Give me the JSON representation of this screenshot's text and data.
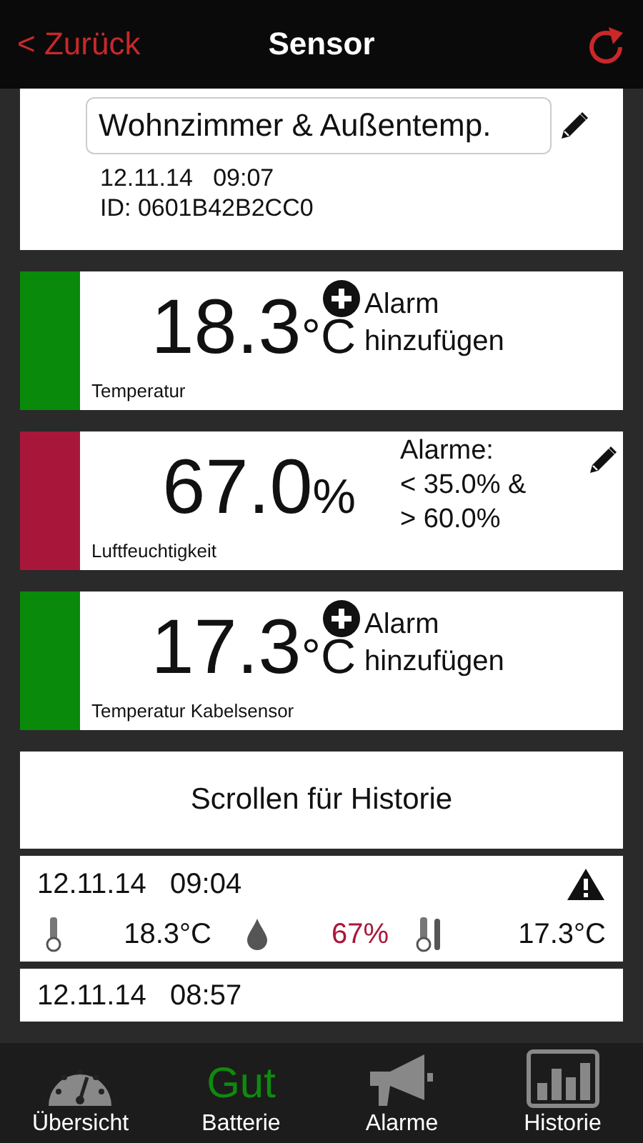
{
  "nav": {
    "back": "< Zurück",
    "title": "Sensor"
  },
  "device": {
    "name": "Wohnzimmer & Außentemp.",
    "timestamp": "12.11.14   09:07",
    "id": "ID: 0601B42B2CC0"
  },
  "sensors": [
    {
      "value": "18.3",
      "unit": "°C",
      "label": "Temperatur",
      "color": "#0a8a0a",
      "kind": "add",
      "alarm_text": "Alarm hinzufügen"
    },
    {
      "value": "67.0",
      "unit": "%",
      "label": "Luftfeuchtigkeit",
      "color": "#a8173a",
      "kind": "edit",
      "alarm_text": "Alarme:\n< 35.0% &\n> 60.0%"
    },
    {
      "value": "17.3",
      "unit": "°C",
      "label": "Temperatur Kabelsensor",
      "color": "#0a8a0a",
      "kind": "add",
      "alarm_text": "Alarm hinzufügen"
    }
  ],
  "scroll_hint": "Scrollen für Historie",
  "history": [
    {
      "timestamp": "12.11.14   09:04",
      "warning": true,
      "readings": [
        {
          "kind": "thermometer",
          "value": "18.3°C",
          "alarm": false
        },
        {
          "kind": "humidity",
          "value": "67%",
          "alarm": true
        },
        {
          "kind": "cable",
          "value": "17.3°C",
          "alarm": false
        }
      ]
    },
    {
      "timestamp": "12.11.14   08:57",
      "warning": false
    }
  ],
  "tabs": [
    {
      "kind": "gauge",
      "label": "Übersicht"
    },
    {
      "kind": "text",
      "status": "Gut",
      "label": "Batterie"
    },
    {
      "kind": "megaphone",
      "label": "Alarme"
    },
    {
      "kind": "chart",
      "label": "Historie"
    }
  ]
}
